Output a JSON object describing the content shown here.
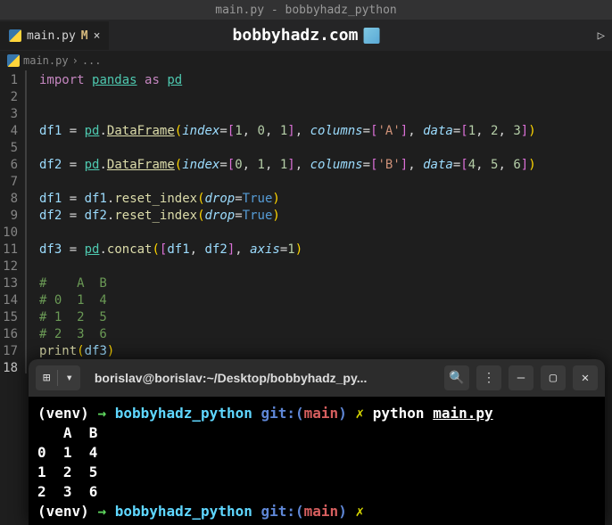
{
  "titleBar": "main.py - bobbyhadz_python",
  "tab": {
    "name": "main.py",
    "modified": "M",
    "close": "×"
  },
  "watermark": "bobbyhadz.com",
  "breadcrumb": {
    "file": "main.py",
    "sep": "›",
    "more": "..."
  },
  "lineNumbers": [
    "1",
    "2",
    "3",
    "4",
    "5",
    "6",
    "7",
    "8",
    "9",
    "10",
    "11",
    "12",
    "13",
    "14",
    "15",
    "16",
    "17",
    "18"
  ],
  "code": {
    "l1": {
      "import": "import",
      "pandas": "pandas",
      "as": "as",
      "pd": "pd"
    },
    "l4": {
      "v": "df1",
      "eq": "=",
      "pd": "pd",
      "dot": ".",
      "fn": "DataFrame",
      "lp": "(",
      "p1": "index",
      "a": "=",
      "lb": "[",
      "n1": "1",
      "c": ",",
      "n2": "0",
      "n3": "1",
      "rb": "]",
      "p2": "columns",
      "s1": "'A'",
      "p3": "data",
      "n4": "1",
      "n5": "2",
      "n6": "3",
      "rp": ")"
    },
    "l6": {
      "v": "df2",
      "eq": "=",
      "pd": "pd",
      "dot": ".",
      "fn": "DataFrame",
      "lp": "(",
      "p1": "index",
      "a": "=",
      "lb": "[",
      "n1": "0",
      "c": ",",
      "n2": "1",
      "n3": "1",
      "rb": "]",
      "p2": "columns",
      "s1": "'B'",
      "p3": "data",
      "n4": "4",
      "n5": "5",
      "n6": "6",
      "rp": ")"
    },
    "l8": {
      "v": "df1",
      "eq": "=",
      "v2": "df1",
      "dot": ".",
      "fn": "reset_index",
      "lp": "(",
      "p": "drop",
      "a": "=",
      "t": "True",
      "rp": ")"
    },
    "l9": {
      "v": "df2",
      "eq": "=",
      "v2": "df2",
      "dot": ".",
      "fn": "reset_index",
      "lp": "(",
      "p": "drop",
      "a": "=",
      "t": "True",
      "rp": ")"
    },
    "l11": {
      "v": "df3",
      "eq": "=",
      "pd": "pd",
      "dot": ".",
      "fn": "concat",
      "lp": "(",
      "lb": "[",
      "v1": "df1",
      "c": ",",
      "v2": "df2",
      "rb": "]",
      "p": "axis",
      "a": "=",
      "n": "1",
      "rp": ")"
    },
    "l13": "#    A  B",
    "l14": "# 0  1  4",
    "l15": "# 1  2  5",
    "l16": "# 2  3  6",
    "l17": {
      "fn": "print",
      "lp": "(",
      "v": "df3",
      "rp": ")"
    }
  },
  "terminal": {
    "title": "borislav@borislav:~/Desktop/bobbyhadz_py...",
    "venv": "(venv)",
    "arrow": "→",
    "path": "bobbyhadz_python",
    "gitL": "git:(",
    "branch": "main",
    "gitR": ")",
    "x": "✗",
    "cmd": "python",
    "file": "main.py",
    "out1": "   A  B",
    "out2": "0  1  4",
    "out3": "1  2  5",
    "out4": "2  3  6",
    "plus": "⊞",
    "down": "▾",
    "search": "🔍",
    "menu": "⋮",
    "min": "–",
    "max": "▢",
    "close": "✕"
  }
}
